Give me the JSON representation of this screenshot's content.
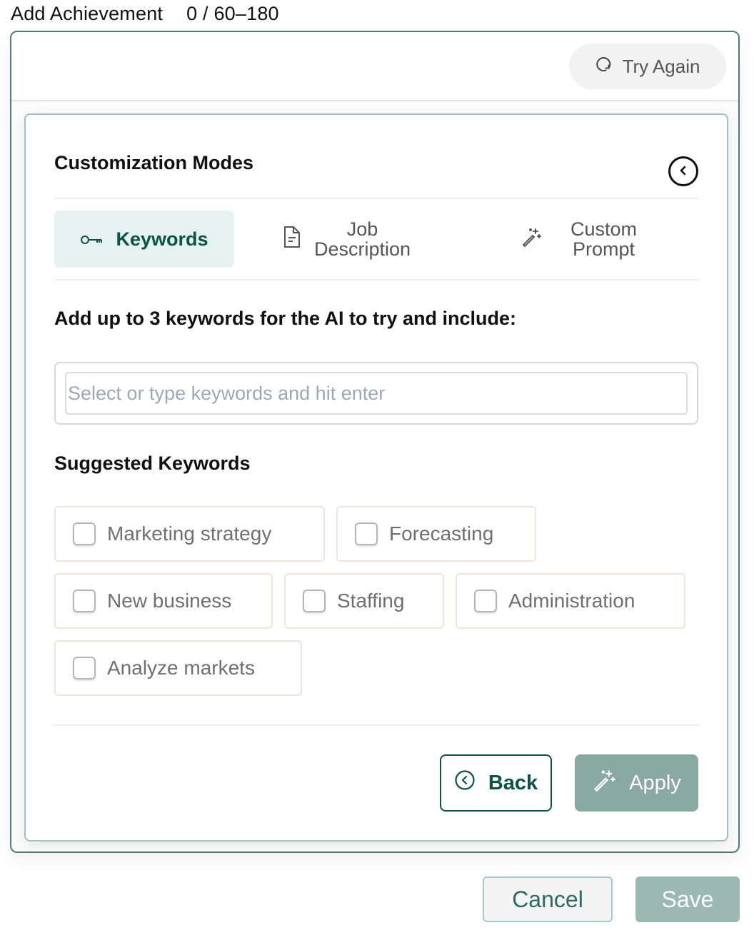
{
  "field": {
    "label": "Add Achievement",
    "counter": "0 / 60–180"
  },
  "toolbar": {
    "try_again_label": "Try Again",
    "try_again_icon": "refresh-icon"
  },
  "panel": {
    "title": "Customization Modes",
    "collapse_icon": "chevron-left-circle-icon",
    "tabs": [
      {
        "label": "Keywords",
        "icon": "key-icon",
        "active": true
      },
      {
        "label_line1": "Job",
        "label_line2": "Description",
        "icon": "document-icon",
        "active": false
      },
      {
        "label_line1": "Custom",
        "label_line2": "Prompt",
        "icon": "magic-wand-icon",
        "active": false
      }
    ],
    "instruction": "Add up to 3 keywords for the AI to try and include:",
    "keyword_input": {
      "value": "",
      "placeholder": "Select or type keywords and hit enter"
    },
    "suggested_title": "Suggested Keywords",
    "suggested_keywords": [
      {
        "label": "Marketing strategy",
        "checked": false
      },
      {
        "label": "Forecasting",
        "checked": false
      },
      {
        "label": "New business",
        "checked": false
      },
      {
        "label": "Staffing",
        "checked": false
      },
      {
        "label": "Administration",
        "checked": false
      },
      {
        "label": "Analyze markets",
        "checked": false
      }
    ],
    "back_label": "Back",
    "apply_label": "Apply"
  },
  "footer": {
    "cancel_label": "Cancel",
    "save_label": "Save"
  },
  "colors": {
    "brand_dark": "#0c5247",
    "active_tab_bg": "#e6f1f1",
    "apply_disabled": "#8aa9a3",
    "save_disabled": "#9bb8b3",
    "outer_border": "#4f7a7a",
    "inner_border": "#9bc1c3"
  }
}
